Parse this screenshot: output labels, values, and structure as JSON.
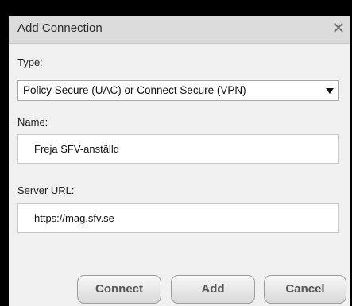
{
  "dialog": {
    "title": "Add Connection",
    "close_glyph": "✕"
  },
  "type_field": {
    "label": "Type:",
    "selected_value": "Policy Secure (UAC) or Connect Secure (VPN)"
  },
  "name_field": {
    "label": "Name:",
    "value": "Freja SFV-anställd"
  },
  "server_url_field": {
    "label": "Server URL:",
    "value": "https://mag.sfv.se"
  },
  "buttons": {
    "connect": "Connect",
    "add": "Add",
    "cancel": "Cancel"
  },
  "colors": {
    "dialog_background": "#f0f0f0",
    "titlebar_background": "#dcdcdc",
    "outer_background": "#000000",
    "button_text": "#555555"
  }
}
